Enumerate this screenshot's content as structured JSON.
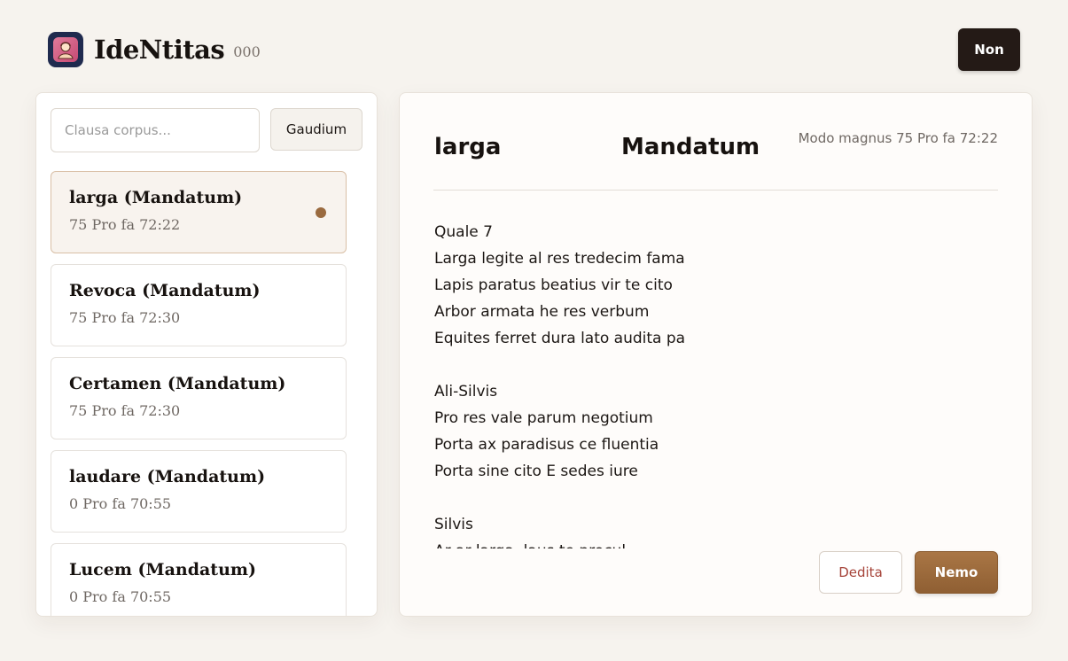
{
  "header": {
    "brand": "IdeNtitas",
    "brand_sub": "000",
    "top_button": "Non"
  },
  "sidebar": {
    "search_placeholder": "Clausa corpus...",
    "search_button": "Gaudium",
    "items": [
      {
        "title": "larga (Mandatum)",
        "meta": "75 Pro fa 72:22",
        "active": true
      },
      {
        "title": "Revoca (Mandatum)",
        "meta": "75 Pro fa 72:30"
      },
      {
        "title": "Certamen (Mandatum)",
        "meta": "75 Pro fa 72:30"
      },
      {
        "title": "laudare (Mandatum)",
        "meta": "0 Pro fa 70:55"
      },
      {
        "title": "Lucem (Mandatum)",
        "meta": "0 Pro fa 70:55"
      }
    ]
  },
  "panel": {
    "title": "larga",
    "title2": "Mandatum",
    "meta": "Modo magnus 75 Pro fa 72:22",
    "lines": [
      "Quale 7",
      "Larga legite al res tredecim fama",
      "Lapis paratus beatius vir te cito",
      "Arbor armata he res verbum",
      "Equites ferret dura lato audita pa",
      "",
      "Ali-Silvis",
      "Pro res vale parum negotium",
      "Porta ax paradisus ce fluentia",
      "Porta sine cito E sedes iure",
      "",
      "Silvis",
      "Ar ar larga, laus te procul"
    ],
    "btn_secondary": "Dedita",
    "btn_primary": "Nemo"
  },
  "colors": {
    "accent": "#9a6a3f",
    "dark_button": "#241a16",
    "danger_text": "#a6443a",
    "background": "#f6f3ee"
  },
  "icons": {
    "logo": "portrait-logo-icon",
    "active_indicator": "dot-indicator"
  }
}
